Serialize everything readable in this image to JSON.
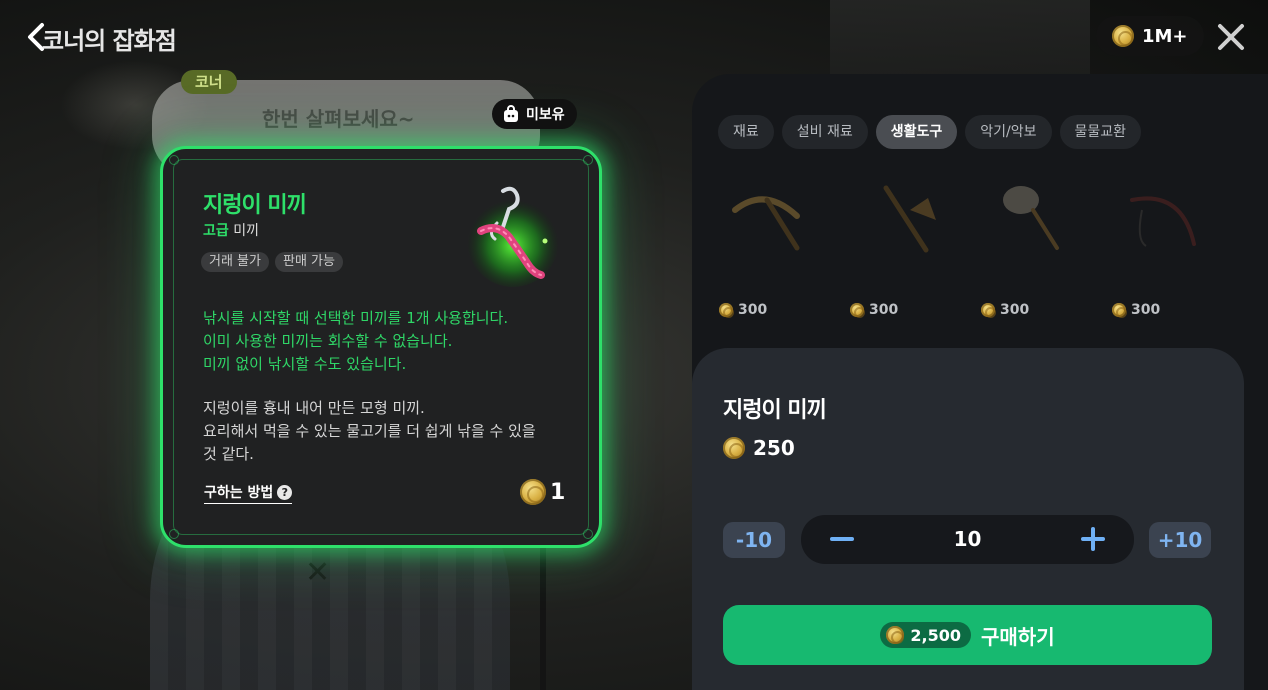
{
  "header": {
    "title": "코너의 잡화점",
    "currency_amount": "1M+"
  },
  "npc": {
    "speaker": "코너",
    "speech": "한번 살펴보세요~"
  },
  "item_card": {
    "ownership_tag": "미보유",
    "name": "지렁이 미끼",
    "grade": "고급",
    "category": "미끼",
    "tags": [
      "거래 불가",
      "판매 가능"
    ],
    "desc_effect": [
      "낚시를 시작할 때 선택한 미끼를 1개 사용합니다.",
      "이미 사용한 미끼는 회수할 수 없습니다.",
      "미끼 없이 낚시할 수도 있습니다."
    ],
    "desc_flavor": [
      "지렁이를 흉내 내어 만든 모형 미끼.",
      "요리해서 먹을 수 있는 물고기를 더 쉽게 낚을 수 있을",
      "것 같다."
    ],
    "how_to_get": "구하는 방법",
    "help_icon": "?",
    "owned_count": "1",
    "accent_color": "#2ee06a"
  },
  "shop": {
    "tabs": [
      {
        "label": "재료",
        "active": false
      },
      {
        "label": "설비 재료",
        "active": false
      },
      {
        "label": "생활도구",
        "active": true
      },
      {
        "label": "악기/악보",
        "active": false
      },
      {
        "label": "물물교환",
        "active": false
      }
    ],
    "items": [
      {
        "icon": "pickaxe-icon",
        "price": "300"
      },
      {
        "icon": "axe-icon",
        "price": "300"
      },
      {
        "icon": "bug-net-icon",
        "price": "300"
      },
      {
        "icon": "fishing-rod-icon",
        "price": "300"
      }
    ]
  },
  "purchase": {
    "name": "지렁이 미끼",
    "unit_price": "250",
    "minus10": "-10",
    "plus10": "+10",
    "quantity": "10",
    "total": "2,500",
    "buy_label": "구매하기",
    "button_color": "#17b970"
  }
}
